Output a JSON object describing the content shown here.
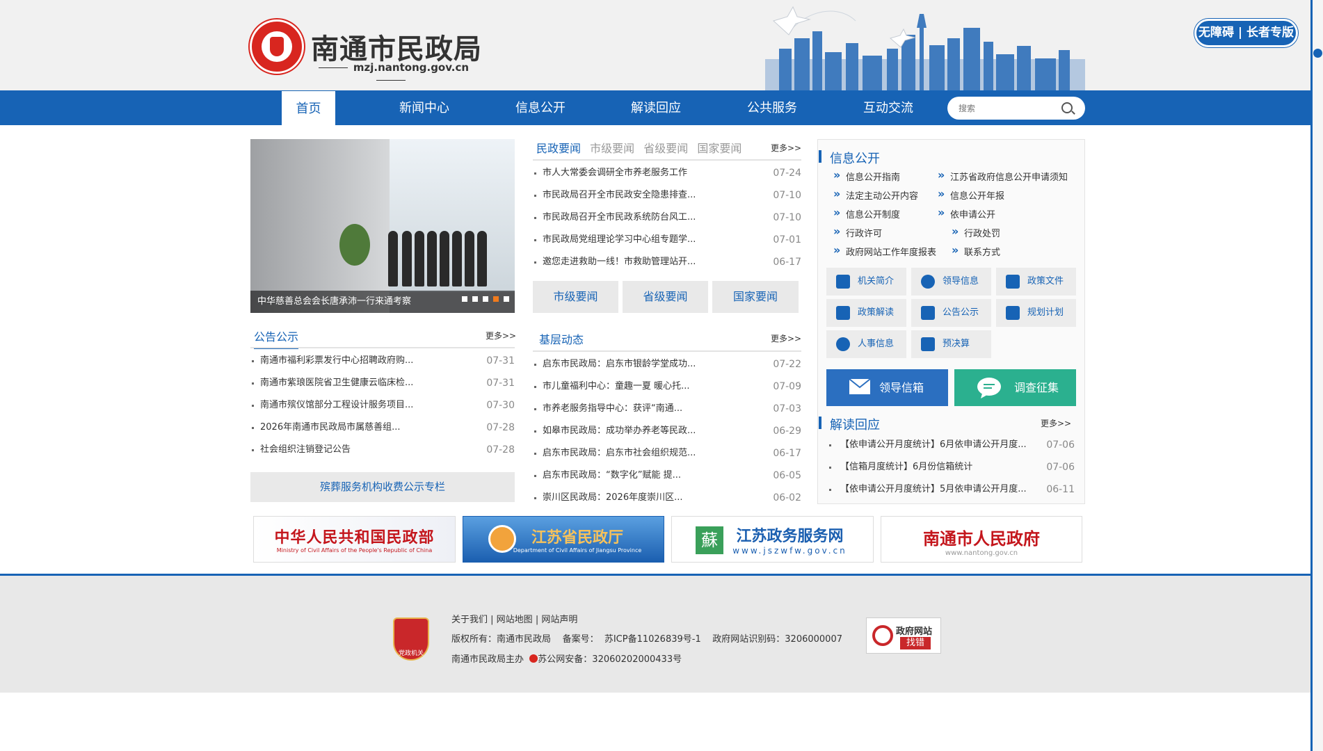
{
  "header": {
    "site_title": "南通市民政局",
    "site_domain": "mzj.nantong.gov.cn",
    "accessibility_label": "无障碍 | 长者专版"
  },
  "nav": {
    "items": [
      "首页",
      "新闻中心",
      "信息公开",
      "解读回应",
      "公共服务",
      "互动交流"
    ],
    "active_index": 0,
    "search_placeholder": "搜索"
  },
  "carousel": {
    "caption": "中华慈善总会会长唐承沛一行来通考察",
    "slide_count": 5,
    "active_slide": 4
  },
  "news": {
    "tabs": [
      "民政要闻",
      "市级要闻",
      "省级要闻",
      "国家要闻"
    ],
    "active_tab": 0,
    "more": "更多>>",
    "items": [
      {
        "title": "市人大常委会调研全市养老服务工作",
        "date": "07-24"
      },
      {
        "title": "市民政局召开全市民政安全隐患排查...",
        "date": "07-10"
      },
      {
        "title": "市民政局召开全市民政系统防台风工...",
        "date": "07-10"
      },
      {
        "title": "市民政局党组理论学习中心组专题学...",
        "date": "07-01"
      },
      {
        "title": "邀您走进救助一线！市救助管理站开...",
        "date": "06-17"
      }
    ],
    "buttons": [
      "市级要闻",
      "省级要闻",
      "国家要闻"
    ]
  },
  "notices": {
    "title": "公告公示",
    "more": "更多>>",
    "items": [
      {
        "title": "南通市福利彩票发行中心招聘政府购...",
        "date": "07-31"
      },
      {
        "title": "南通市紫琅医院省卫生健康云临床检...",
        "date": "07-31"
      },
      {
        "title": "南通市殡仪馆部分工程设计服务项目...",
        "date": "07-30"
      },
      {
        "title": "2026年南通市民政局市属慈善组...",
        "date": "07-28"
      },
      {
        "title": "社会组织注销登记公告",
        "date": "07-28"
      }
    ],
    "funeral_link": "殡葬服务机构收费公示专栏"
  },
  "grassroots": {
    "title": "基层动态",
    "more": "更多>>",
    "items": [
      {
        "title": "启东市民政局：启东市银龄学堂成功...",
        "date": "07-22"
      },
      {
        "title": "市儿童福利中心：童趣一夏 暖心托...",
        "date": "07-09"
      },
      {
        "title": "市养老服务指导中心：获评“南通...",
        "date": "07-03"
      },
      {
        "title": "如皋市民政局：成功举办养老等民政...",
        "date": "06-29"
      },
      {
        "title": "启东市民政局：启东市社会组织规范...",
        "date": "06-17"
      },
      {
        "title": "启东市民政局：“数字化”赋能 提...",
        "date": "06-05"
      },
      {
        "title": "崇川区民政局：2026年度崇川区...",
        "date": "06-02"
      }
    ]
  },
  "info_public": {
    "title": "信息公开",
    "links": [
      "信息公开指南",
      "江苏省政府信息公开申请须知",
      "法定主动公开内容",
      "信息公开年报",
      "信息公开制度",
      "依申请公开",
      "行政许可",
      "行政处罚",
      "政府网站工作年度报表",
      "联系方式"
    ],
    "buttons": [
      {
        "label": "机关简介",
        "icon": "org-chart-icon"
      },
      {
        "label": "领导信息",
        "icon": "person-icon"
      },
      {
        "label": "政策文件",
        "icon": "document-icon"
      },
      {
        "label": "政策解读",
        "icon": "book-icon"
      },
      {
        "label": "公告公示",
        "icon": "clipboard-icon"
      },
      {
        "label": "规划计划",
        "icon": "plan-icon"
      },
      {
        "label": "人事信息",
        "icon": "people-icon"
      },
      {
        "label": "预决算",
        "icon": "grid-icon"
      }
    ],
    "mailbox": "领导信箱",
    "survey": "调查征集"
  },
  "interpretation": {
    "title": "解读回应",
    "more": "更多>>",
    "items": [
      {
        "title": "【依申请公开月度统计】6月依申请公开月度...",
        "date": "07-06"
      },
      {
        "title": "【信箱月度统计】6月份信箱统计",
        "date": "07-06"
      },
      {
        "title": "【依申请公开月度统计】5月依申请公开月度...",
        "date": "06-11"
      }
    ]
  },
  "banners": [
    {
      "title": "中华人民共和国民政部",
      "subtitle": "Ministry of Civil Affairs of the People's Republic of China"
    },
    {
      "title": "江苏省民政厅",
      "subtitle": "Department of Civil Affairs of Jiangsu Province"
    },
    {
      "title": "江苏政务服务网",
      "subtitle": "www.jszwfw.gov.cn",
      "badge": "蘇"
    },
    {
      "title": "南通市人民政府",
      "subtitle": "www.nantong.gov.cn"
    }
  ],
  "footer": {
    "links": [
      "关于我们",
      "网站地图",
      "网站声明"
    ],
    "copyright_label": "版权所有：",
    "copyright": "南通市民政局",
    "icp_label": "备案号：",
    "icp": "苏ICP备11026839号-1",
    "gov_id_label": "政府网站识别码：",
    "gov_id": "3206000007",
    "sponsor": "南通市民政局主办",
    "police_label": "苏公网安备：",
    "police": "32060202000433号",
    "party_badge": "党政机关",
    "error_title": "政府网站",
    "error_action": "找错"
  },
  "colors": {
    "primary": "#1763b5",
    "logo_red": "#d8261f",
    "accent_orange": "#f07b1d",
    "mailbox_blue": "#2b6fc0",
    "survey_green": "#2bb08f"
  }
}
